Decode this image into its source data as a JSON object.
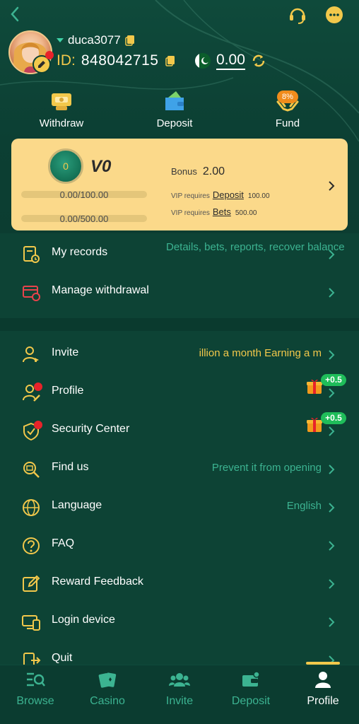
{
  "header": {
    "username": "duca3077",
    "id_label": "ID:",
    "id_value": "848042715",
    "balance": "0.00"
  },
  "quick_actions": {
    "withdraw": "Withdraw",
    "deposit": "Deposit",
    "fund": "Fund",
    "fund_badge": "8%"
  },
  "vip": {
    "level": "V0",
    "medal_text": "0",
    "progress_deposit": "0.00/100.00",
    "progress_bets": "0.00/500.00",
    "progress_deposit_fraction": 0,
    "progress_bets_fraction": 0,
    "bonus_label": "Bonus",
    "bonus_value": "2.00",
    "req_label_1": "VIP requires",
    "req_link_1": "Deposit",
    "req_amount_1": "100.00",
    "req_label_2": "VIP requires",
    "req_link_2": "Bets",
    "req_amount_2": "500.00"
  },
  "menu_top": [
    {
      "label": "My records",
      "value": "Details, bets, reports, recover balance"
    },
    {
      "label": "Manage withdrawal",
      "value": ""
    }
  ],
  "menu_main": [
    {
      "label": "Invite",
      "value": "illion a month  Earning a m"
    },
    {
      "label": "Profile",
      "value": "",
      "gift_badge": "+0.5"
    },
    {
      "label": "Security Center",
      "value": "",
      "gift_badge": "+0.5"
    },
    {
      "label": "Find us",
      "value": "Prevent it from opening"
    },
    {
      "label": "Language",
      "value": "English"
    },
    {
      "label": "FAQ",
      "value": ""
    },
    {
      "label": "Reward Feedback",
      "value": ""
    },
    {
      "label": "Login device",
      "value": ""
    },
    {
      "label": "Quit",
      "value": ""
    }
  ],
  "bottom_nav": [
    {
      "label": "Browse",
      "active": false
    },
    {
      "label": "Casino",
      "active": false
    },
    {
      "label": "Invite",
      "active": false
    },
    {
      "label": "Deposit",
      "active": false
    },
    {
      "label": "Profile",
      "active": true
    }
  ],
  "colors": {
    "background": "#0d4335",
    "accent_gold": "#f2c84b",
    "accent_teal": "#3cb391",
    "vip_card": "#fbd98a",
    "badge_green": "#1fbd5a",
    "notification_red": "#e8232a"
  }
}
